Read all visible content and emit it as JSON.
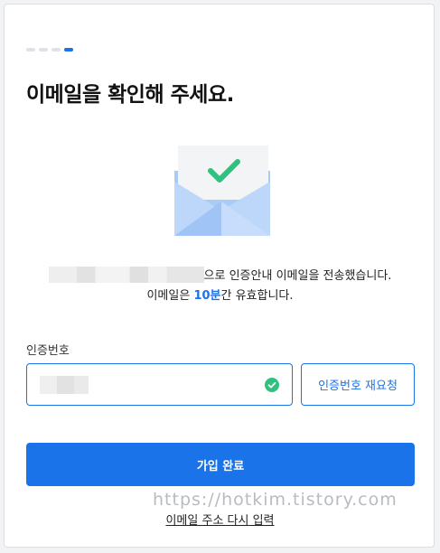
{
  "steps": {
    "total": 4,
    "current": 4
  },
  "title": "이메일을 확인해 주세요.",
  "message": {
    "line1_suffix": "으로 인증안내 이메일을 전송했습니다.",
    "line2_prefix": "이메일은 ",
    "line2_highlight": "10분",
    "line2_suffix": "간 유효합니다."
  },
  "code_field": {
    "label": "인증번호",
    "status_icon": "check-circle-icon"
  },
  "resend_button_label": "인증번호 재요청",
  "submit_button_label": "가입 완료",
  "watermark": "https://hotkim.tistory.com",
  "reenter_link_label": "이메일 주소 다시 입력",
  "colors": {
    "accent": "#1a73e8",
    "success": "#2ec27e",
    "envelope": "#a9cbf7"
  },
  "icons": {
    "illustration": "envelope-check-icon"
  }
}
